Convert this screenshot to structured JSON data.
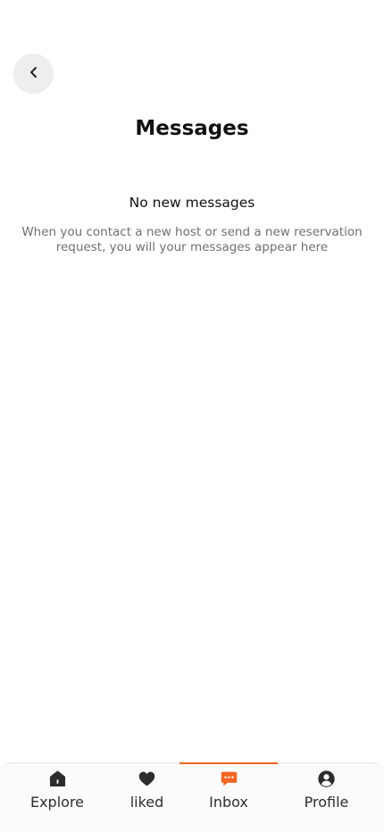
{
  "header": {
    "back_icon": "chevron-left-icon",
    "title": "Messages"
  },
  "empty_state": {
    "heading": "No new messages",
    "body": "When you contact a new host or send a new reservation request, you will your messages appear here"
  },
  "tabbar": {
    "active_color": "#f26522",
    "inactive_icon_color": "#2d2d2d",
    "tabs": [
      {
        "label": "Explore",
        "icon": "home-icon",
        "active": false
      },
      {
        "label": "liked",
        "icon": "heart-icon",
        "active": false
      },
      {
        "label": "Inbox",
        "icon": "chat-icon",
        "active": true
      },
      {
        "label": "Profile",
        "icon": "user-icon",
        "active": false
      }
    ]
  }
}
